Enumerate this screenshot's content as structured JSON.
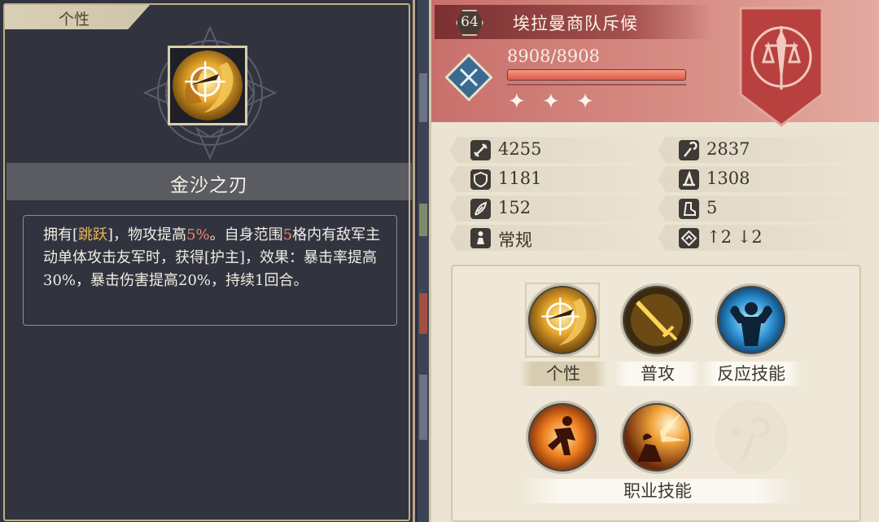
{
  "left_panel": {
    "tab_label": "个性",
    "skill_name": "金沙之刃",
    "description": {
      "p1": "拥有[",
      "p2": "跳跃",
      "p3": "]，物攻提高",
      "p4": "5%",
      "p5": "。自身范围",
      "p6": "5",
      "p7": "格内有敌军主动单体攻击友军时，获得[护主]，效果：暴击率提高30%，暴击伤害提高20%，持续1回合。"
    }
  },
  "character": {
    "level": "64",
    "name": "埃拉曼商队斥候",
    "hp": "8908/8908",
    "hp_fraction": 1.0,
    "stars": "✦ ✦ ✦"
  },
  "stats": {
    "attack": "4255",
    "magic_attack": "2837",
    "defense": "1181",
    "magic_defense": "1308",
    "technique": "152",
    "movement": "5",
    "terrain": "常规",
    "height": "↑2 ↓2"
  },
  "skills": {
    "personality": "个性",
    "normal_attack": "普攻",
    "reaction": "反应技能",
    "class_skill": "职业技能"
  },
  "colors": {
    "accent_gold": "#e9b55c",
    "accent_red": "#ef8a67",
    "header_red": "#c9706c"
  }
}
